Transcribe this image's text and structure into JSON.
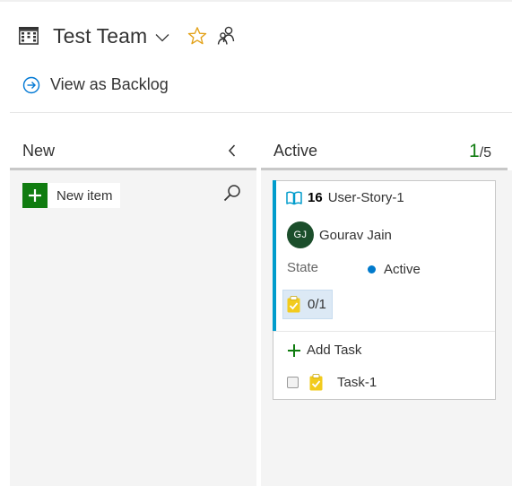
{
  "header": {
    "team_name": "Test Team",
    "board_icon": "board-grid-icon",
    "dropdown_icon": "chevron-down-icon",
    "favorite_icon": "star-icon",
    "team_members_icon": "people-icon"
  },
  "backlog_link": {
    "label": "View as Backlog",
    "icon": "arrow-circle-right-icon"
  },
  "columns": [
    {
      "title": "New",
      "new_item_label": "New item",
      "collapse_icon": "chevron-left-icon",
      "search_icon": "search-icon"
    },
    {
      "title": "Active",
      "count_current": "1",
      "count_limit": "/5"
    }
  ],
  "card": {
    "work_item_type_icon": "book-icon",
    "id": "16",
    "title": "User-Story-1",
    "assignee": {
      "initials": "GJ",
      "name": "Gourav Jain"
    },
    "state_label": "State",
    "state_value": "Active",
    "child_progress": "0/1",
    "add_task_label": "Add Task",
    "tasks": [
      {
        "title": "Task-1"
      }
    ]
  },
  "colors": {
    "accent_green": "#107c10",
    "card_accent": "#009ccc",
    "state_active": "#007acc",
    "task_yellow": "#f2cb1d",
    "avatar_bg": "#1b4e2b",
    "column_bg": "#f4f4f4"
  }
}
